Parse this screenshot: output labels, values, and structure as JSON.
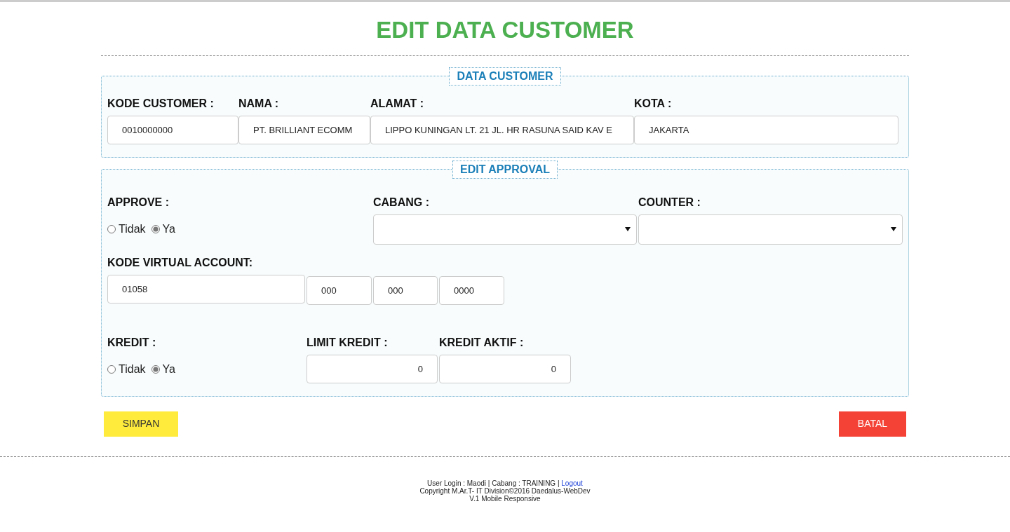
{
  "title": "EDIT DATA CUSTOMER",
  "data_customer": {
    "legend": "DATA CUSTOMER",
    "fields": [
      {
        "label": "KODE CUSTOMER :",
        "value": "0010000000"
      },
      {
        "label": "NAMA :",
        "value": "PT. BRILLIANT ECOMM"
      },
      {
        "label": "ALAMAT :",
        "value": "LIPPO KUNINGAN LT. 21 JL. HR RASUNA SAID KAV E"
      },
      {
        "label": "KOTA :",
        "value": "JAKARTA"
      }
    ]
  },
  "edit_approval": {
    "legend": "EDIT APPROVAL",
    "approve": {
      "label": "APPROVE :",
      "options": [
        {
          "label": "Tidak",
          "selected": false
        },
        {
          "label": "Ya",
          "selected": true
        }
      ]
    },
    "cabang": {
      "label": "CABANG :"
    },
    "counter": {
      "label": "COUNTER :"
    },
    "virtual_account": {
      "label": "KODE VIRTUAL ACCOUNT:",
      "values": [
        "01058",
        "000",
        "000",
        "0000"
      ]
    },
    "kredit": {
      "label": "KREDIT :",
      "options": [
        {
          "label": "Tidak",
          "selected": false
        },
        {
          "label": "Ya",
          "selected": true
        }
      ]
    },
    "limit_kredit": {
      "label": "LIMIT KREDIT :",
      "value": "0"
    },
    "kredit_aktif": {
      "label": "KREDIT AKTIF :",
      "value": "0"
    }
  },
  "buttons": {
    "save": "SIMPAN",
    "cancel": "BATAL"
  },
  "footer": {
    "login_text": "User Login : Maodi | Cabang : TRAINING |",
    "logout": "Logout",
    "copyright": "Copyright M.Ar.T- IT Division©2016 Daedalus-WebDev",
    "version": "V.1 Mobile Responsive"
  }
}
